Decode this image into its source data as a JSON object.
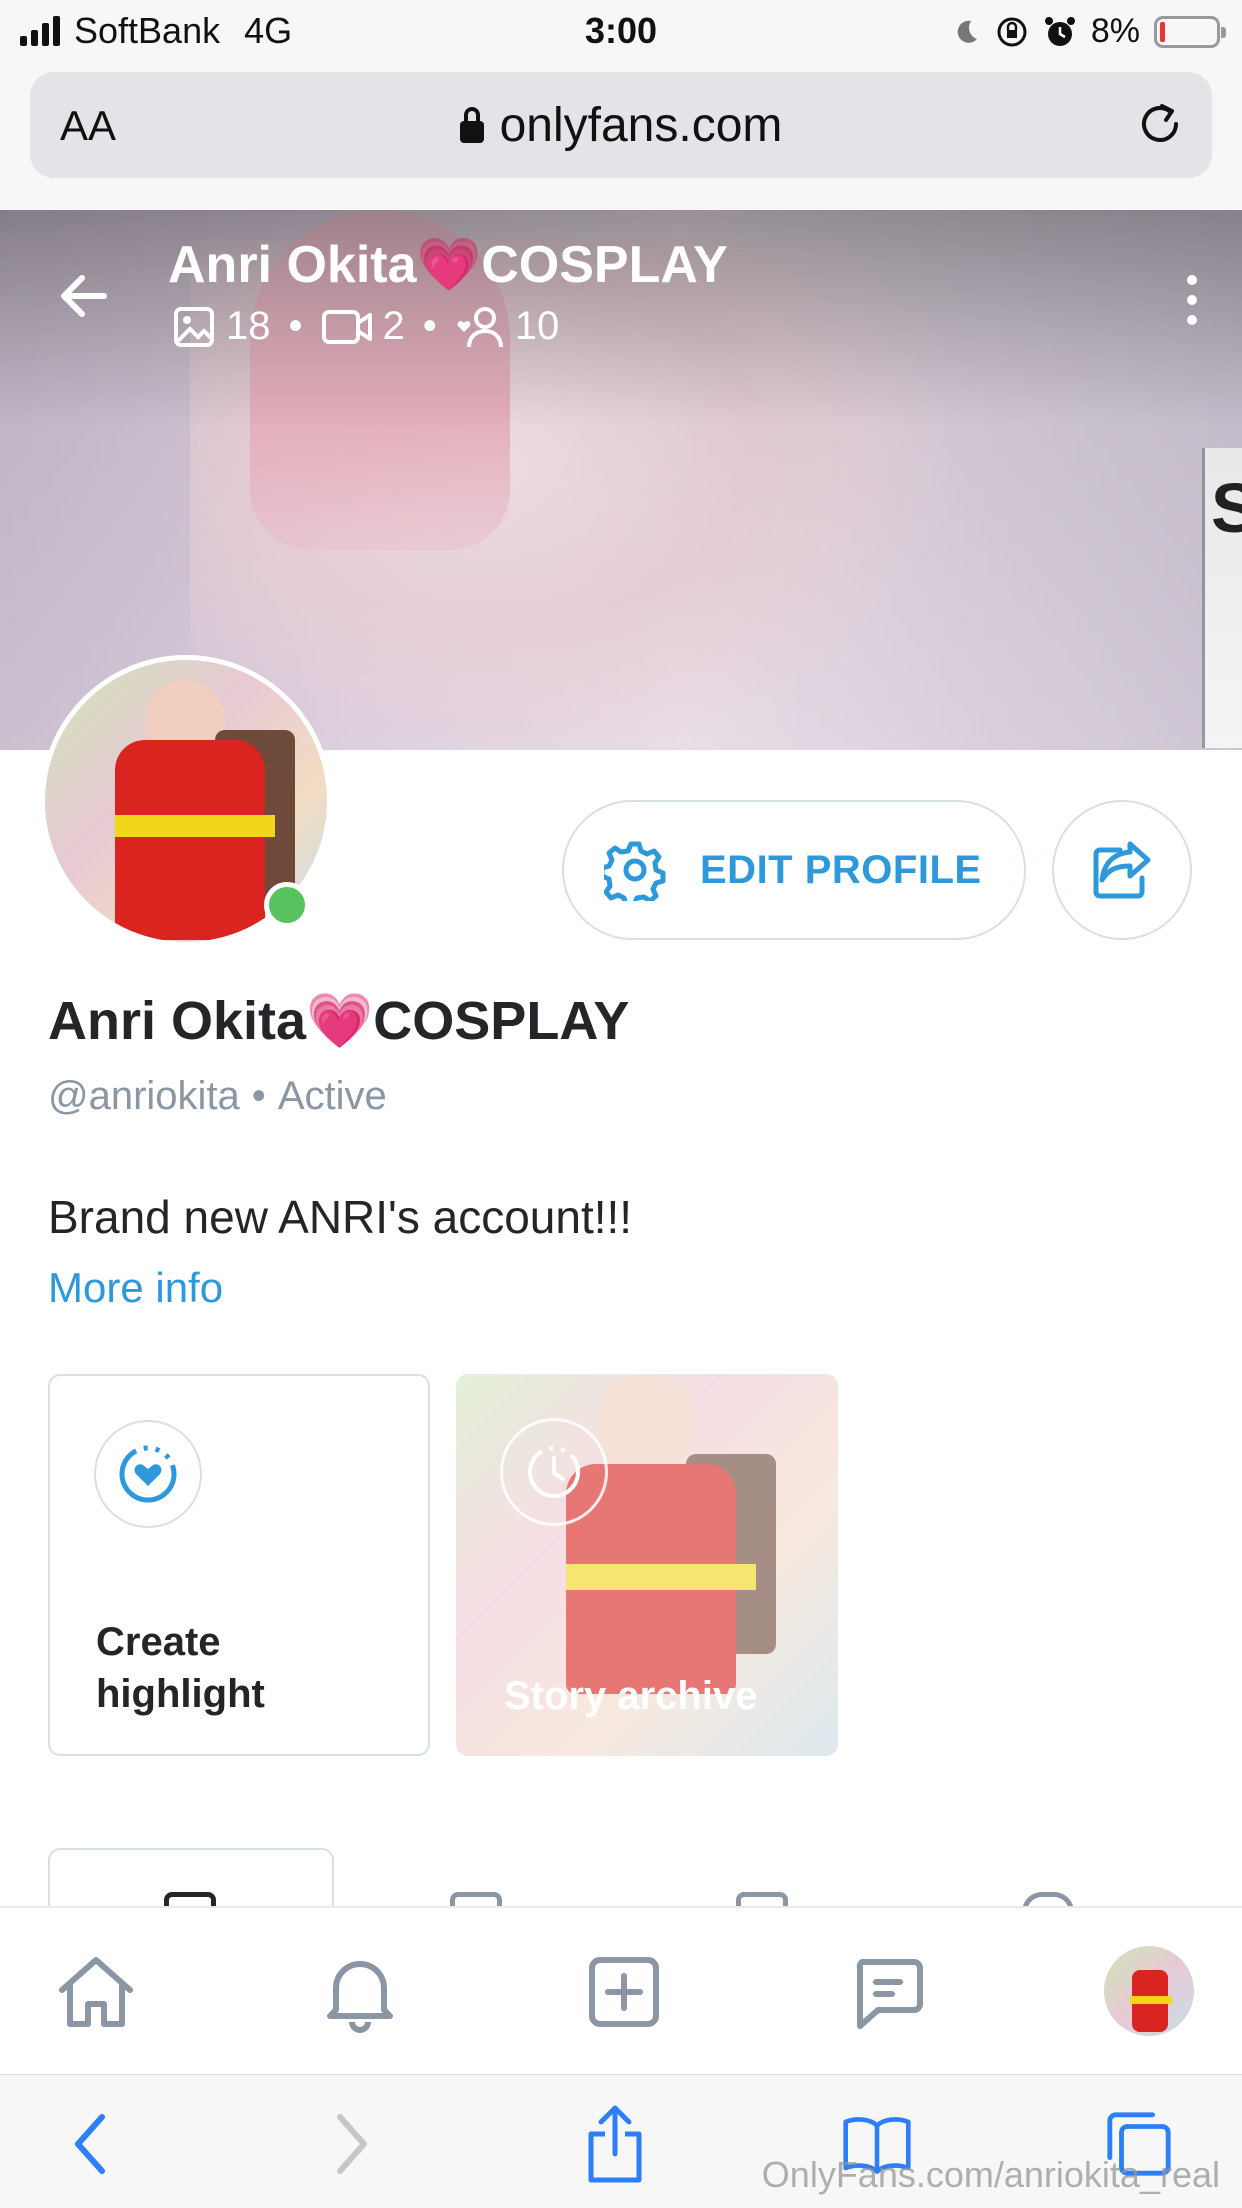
{
  "status_bar": {
    "carrier": "SoftBank",
    "network": "4G",
    "time": "3:00",
    "battery": "8%"
  },
  "browser": {
    "aa_label": "AA",
    "url": "onlyfans.com"
  },
  "cover": {
    "title": "Anri Okita💗COSPLAY",
    "photos_count": "18",
    "videos_count": "2",
    "fans_count": "10",
    "sign_letter": "S"
  },
  "profile": {
    "name": "Anri Okita💗COSPLAY",
    "handle": "@anriokita",
    "separator": "•",
    "status": "Active",
    "bio": "Brand new ANRI's account!!!",
    "more_info": "More info",
    "edit_profile": "EDIT PROFILE"
  },
  "highlights": {
    "create_label": "Create highlight",
    "archive_label": "Story archive"
  },
  "watermark": "OnlyFans.com/anriokita_real",
  "colors": {
    "accent": "#2d98da",
    "online": "#58c25e",
    "muted": "#8a96a3"
  }
}
